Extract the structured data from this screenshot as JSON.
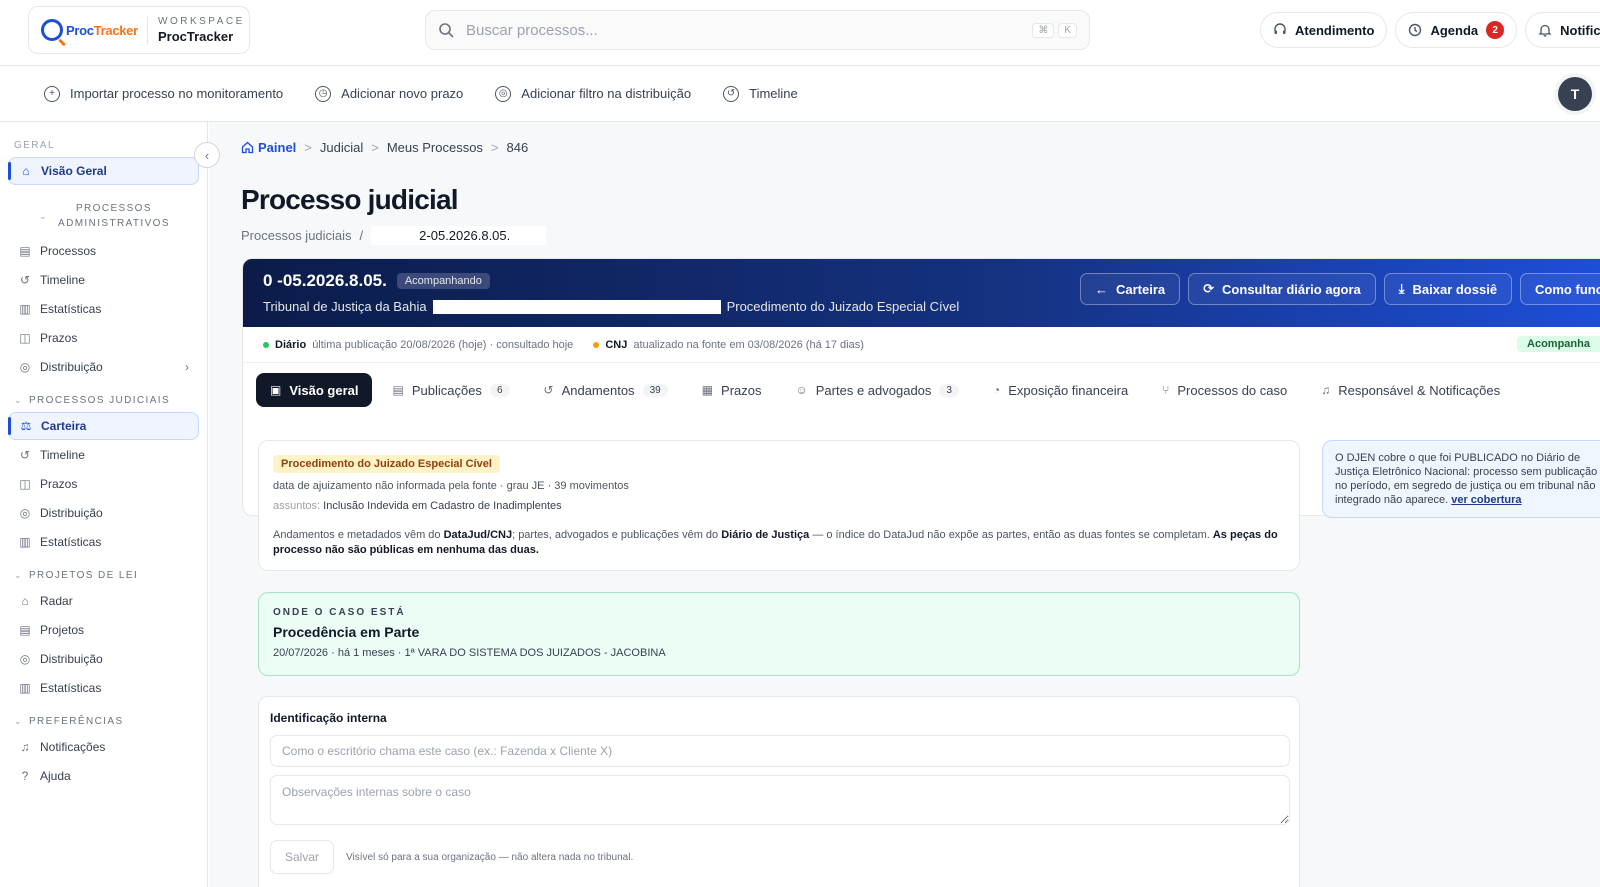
{
  "workspace": {
    "logo_a": "Proc",
    "logo_b": "Tracker",
    "label": "WORKSPACE",
    "name": "ProcTracker"
  },
  "search": {
    "placeholder": "Buscar processos...",
    "kbd_cmd": "⌘",
    "kbd_key": "K"
  },
  "top_actions": {
    "atendimento": "Atendimento",
    "agenda": "Agenda",
    "agenda_count": "2",
    "notificacoes": "Notificaçõe"
  },
  "actionbar": {
    "importar": "Importar processo no monitoramento",
    "prazo": "Adicionar novo prazo",
    "filtro": "Adicionar filtro na distribuição",
    "timeline": "Timeline",
    "avatar": "T"
  },
  "sidebar": {
    "geral": "GERAL",
    "visao_geral": "Visão Geral",
    "adm_title": "PROCESSOS ADMINISTRATIVOS",
    "adm_items": [
      "Processos",
      "Timeline",
      "Estatísticas",
      "Prazos",
      "Distribuição"
    ],
    "jud_title": "PROCESSOS JUDICIAIS",
    "jud_items": [
      "Carteira",
      "Timeline",
      "Prazos",
      "Distribuição",
      "Estatísticas"
    ],
    "lei_title": "PROJETOS DE LEI",
    "lei_items": [
      "Radar",
      "Projetos",
      "Distribuição",
      "Estatísticas"
    ],
    "pref_title": "PREFERÊNCIAS",
    "pref_items": [
      "Notificações",
      "Ajuda"
    ]
  },
  "breadcrumb": {
    "home": "Painel",
    "c1": "Judicial",
    "c2": "Meus Processos",
    "c3": "846"
  },
  "page": {
    "title": "Processo judicial",
    "sub_label": "Processos judiciais",
    "sub_sep": "/",
    "sub_number": "2-05.2026.8.05."
  },
  "case": {
    "number": "0         -05.2026.8.05.",
    "status": "Acompanhando",
    "court": "Tribunal de Justiça da Bahia",
    "proc_type": "Procedimento do Juizado Especial Cível",
    "btn_carteira": "Carteira",
    "btn_consultar": "Consultar diário agora",
    "btn_baixar": "Baixar dossiê",
    "btn_como": "Como funcio",
    "diario_label": "Diário",
    "diario_text": "última publicação 20/08/2026 (hoje) · consultado hoje",
    "cnj_label": "CNJ",
    "cnj_text": "atualizado na fonte em 03/08/2026 (há 17 dias)",
    "status_tag": "Acompanha"
  },
  "tabs": [
    {
      "label": "Visão geral",
      "count": ""
    },
    {
      "label": "Publicações",
      "count": "6"
    },
    {
      "label": "Andamentos",
      "count": "39"
    },
    {
      "label": "Prazos",
      "count": ""
    },
    {
      "label": "Partes e advogados",
      "count": "3"
    },
    {
      "label": "Exposição financeira",
      "count": ""
    },
    {
      "label": "Processos do caso",
      "count": ""
    },
    {
      "label": "Responsável & Notificações",
      "count": ""
    }
  ],
  "info": {
    "tag": "Procedimento do Juizado Especial Cível",
    "meta": "data de ajuizamento não informada pela fonte · grau JE · 39 movimentos",
    "assunto_label": "assuntos:",
    "assunto_value": "Inclusão Indevida em Cadastro de Inadimplentes",
    "note_1": "Andamentos e metadados vêm do ",
    "note_b1": "DataJud/CNJ",
    "note_2": "; partes, advogados e publicações vêm do ",
    "note_b2": "Diário de Justiça",
    "note_3": " — o índice do DataJud não expõe as partes, então as duas fontes se completam. ",
    "note_b3": "As peças do processo não são públicas em nenhuma das duas."
  },
  "side_note": {
    "text": "O DJEN cobre o que foi PUBLICADO no Diário de Justiça Eletrônico Nacional: processo sem publicação no período, em segredo de justiça ou em tribunal não integrado não aparece.",
    "link": "ver cobertura"
  },
  "where": {
    "label": "ONDE O CASO ESTÁ",
    "title": "Procedência em Parte",
    "meta": "20/07/2026 · há 1 meses · 1ª VARA DO SISTEMA DOS JUIZADOS - JACOBINA"
  },
  "identificacao": {
    "title": "Identificação interna",
    "name_placeholder": "Como o escritório chama este caso (ex.: Fazenda x Cliente X)",
    "obs_placeholder": "Observações internas sobre o caso",
    "save": "Salvar",
    "footnote": "Visível só para a sua organização — não altera nada no tribunal."
  }
}
